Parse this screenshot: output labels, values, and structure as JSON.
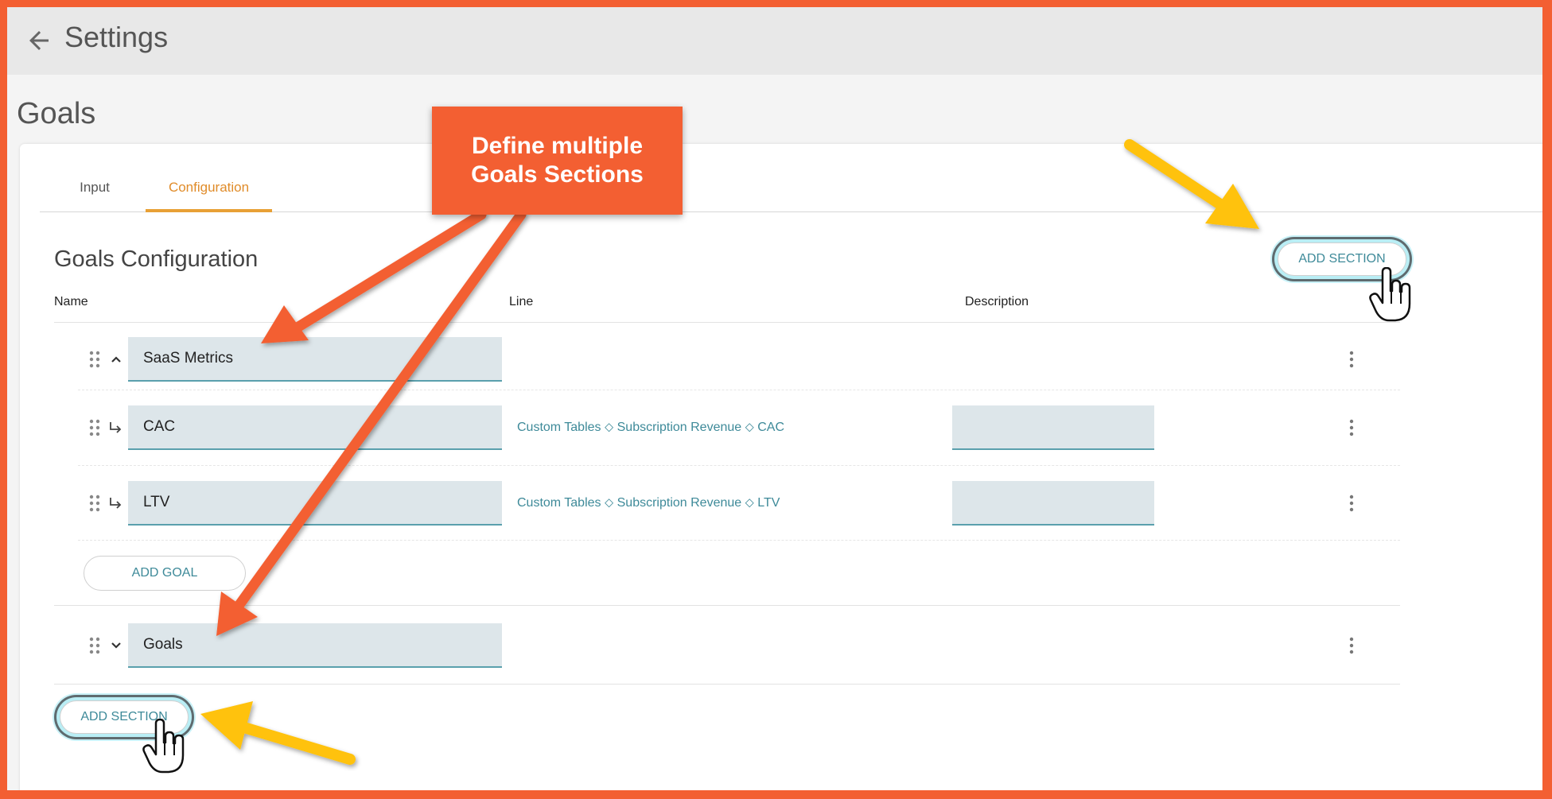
{
  "header": {
    "title": "Settings",
    "back_icon": "arrow-left-icon"
  },
  "page": {
    "title": "Goals"
  },
  "tabs": [
    {
      "label": "Input",
      "active": false
    },
    {
      "label": "Configuration",
      "active": true
    }
  ],
  "config": {
    "heading": "Goals Configuration",
    "add_section_label": "ADD SECTION",
    "columns": {
      "name": "Name",
      "line": "Line",
      "description": "Description"
    },
    "sections": [
      {
        "name": "SaaS Metrics",
        "expanded": true,
        "goals": [
          {
            "name": "CAC",
            "line": "Custom Tables ⬦ Subscription Revenue ⬦ CAC",
            "description": ""
          },
          {
            "name": "LTV",
            "line": "Custom Tables ⬦ Subscription Revenue ⬦ LTV",
            "description": ""
          }
        ],
        "add_goal_label": "ADD GOAL"
      },
      {
        "name": "Goals",
        "expanded": false,
        "goals": []
      }
    ]
  },
  "annotation": {
    "callout_line1": "Define multiple",
    "callout_line2": "Goals Sections"
  },
  "colors": {
    "accent_orange": "#e8a035",
    "link_teal": "#3e8a99",
    "frame_orange": "#f35f32",
    "arrow_yellow": "#ffc20e"
  },
  "icons": [
    "arrow-left-icon",
    "drag-handle-icon",
    "chevron-up-icon",
    "chevron-down-icon",
    "subdirectory-arrow-icon",
    "more-vert-icon",
    "hand-pointer-icon"
  ]
}
